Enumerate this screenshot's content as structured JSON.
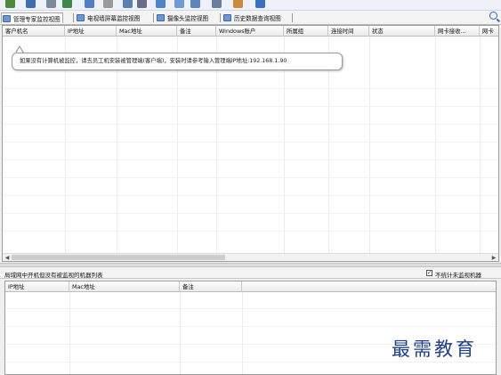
{
  "toolbar": {
    "icons": [
      "start-icon",
      "monitor-icon",
      "user-icon",
      "refresh-icon",
      "chart-icon",
      "lock-icon",
      "network-icon",
      "gear-icon",
      "screen-icon",
      "mail-icon",
      "message-icon",
      "person-icon",
      "window-icon",
      "flag-icon"
    ],
    "search_icon": "search-icon"
  },
  "tabs": [
    {
      "label": "管理专家监控视图",
      "active": true
    },
    {
      "label": "电视墙屏幕监控视图",
      "active": false
    },
    {
      "label": "摄像头监控视图",
      "active": false
    },
    {
      "label": "历史数据查询视图",
      "active": false
    }
  ],
  "clients": {
    "columns": [
      "客户机名",
      "IP地址",
      "Mac地址",
      "备注",
      "Windows账户",
      "所属组",
      "连接时间",
      "状态",
      "网卡接收...",
      "网卡"
    ],
    "tooltip": "如果没有计算机被监控，请去员工机安装被管理端(客户端)，安装时请参考输入管理端IP地址:192.168.1.90"
  },
  "unmonitored": {
    "title": "局域网中开机但没有被监视的机器列表",
    "checkbox_label": "不统计未监视机器",
    "checkbox_checked": true,
    "checkbox_mark": "✓",
    "columns": [
      "IP地址",
      "Mac地址",
      "备注"
    ]
  },
  "watermark": "最需教育",
  "colors": {
    "watermark": "#1d3f8c",
    "accent": "#2d67b9"
  }
}
